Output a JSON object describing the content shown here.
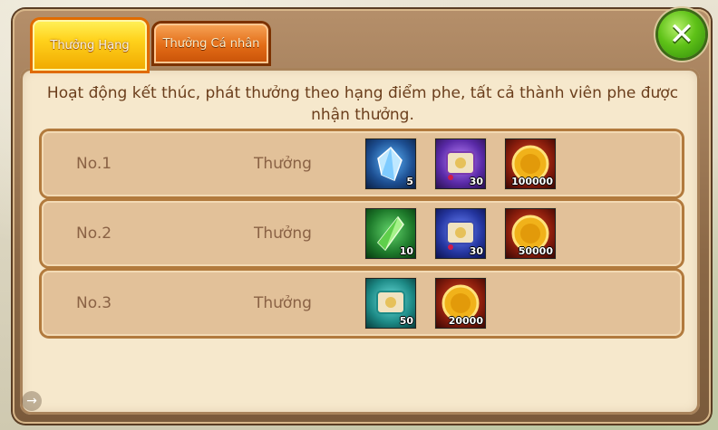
{
  "tabs": [
    {
      "label": "Thưởng Hạng",
      "active": true
    },
    {
      "label": "Thưởng Cá nhân",
      "active": false
    }
  ],
  "close_icon": "close-x-icon",
  "notice": "Hoạt động kết thúc, phát thưởng theo hạng điểm phe, tất cả thành viên phe được nhận thưởng.",
  "rows": [
    {
      "rank": "No.1",
      "reward_label": "Thưởng",
      "items": [
        {
          "icon": "blue-crystal-icon",
          "qty": "5"
        },
        {
          "icon": "purple-scroll-icon",
          "qty": "30"
        },
        {
          "icon": "gold-coin-icon",
          "qty": "100000"
        }
      ]
    },
    {
      "rank": "No.2",
      "reward_label": "Thưởng",
      "items": [
        {
          "icon": "green-crystal-icon",
          "qty": "10"
        },
        {
          "icon": "blue-scroll-icon",
          "qty": "30"
        },
        {
          "icon": "gold-coin-icon",
          "qty": "50000"
        }
      ]
    },
    {
      "rank": "No.3",
      "reward_label": "Thưởng",
      "items": [
        {
          "icon": "teal-scroll-icon",
          "qty": "50"
        },
        {
          "icon": "gold-coin-icon",
          "qty": "20000"
        }
      ]
    }
  ],
  "colors": {
    "panel": "#f6e8cc",
    "row": "#e2c199",
    "text_brown": "#6b3e1c",
    "tab_active": "#ffd21c",
    "tab_inactive": "#e36c16",
    "close_green": "#5fc218"
  }
}
